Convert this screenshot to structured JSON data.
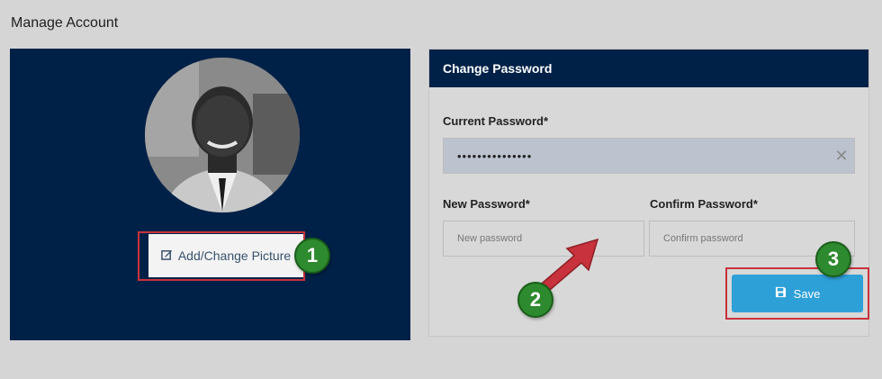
{
  "page": {
    "title": "Manage Account"
  },
  "profile": {
    "change_picture_label": "Add/Change Picture",
    "edit_icon": "edit-square-icon"
  },
  "password": {
    "header": "Change Password",
    "current_label": "Current Password*",
    "current_value": "•••••••••••••••",
    "new_label": "New Password*",
    "new_placeholder": "New password",
    "confirm_label": "Confirm Password*",
    "confirm_placeholder": "Confirm password",
    "save_label": "Save",
    "clear_icon": "close-icon",
    "save_icon": "floppy-disk-icon"
  },
  "callouts": {
    "one": "1",
    "two": "2",
    "three": "3"
  },
  "colors": {
    "panel_navy": "#002147",
    "save_blue": "#2ea0d8",
    "callout_red": "#c8323c",
    "badge_green": "#2e8a2e",
    "background": "#d5d5d5"
  }
}
